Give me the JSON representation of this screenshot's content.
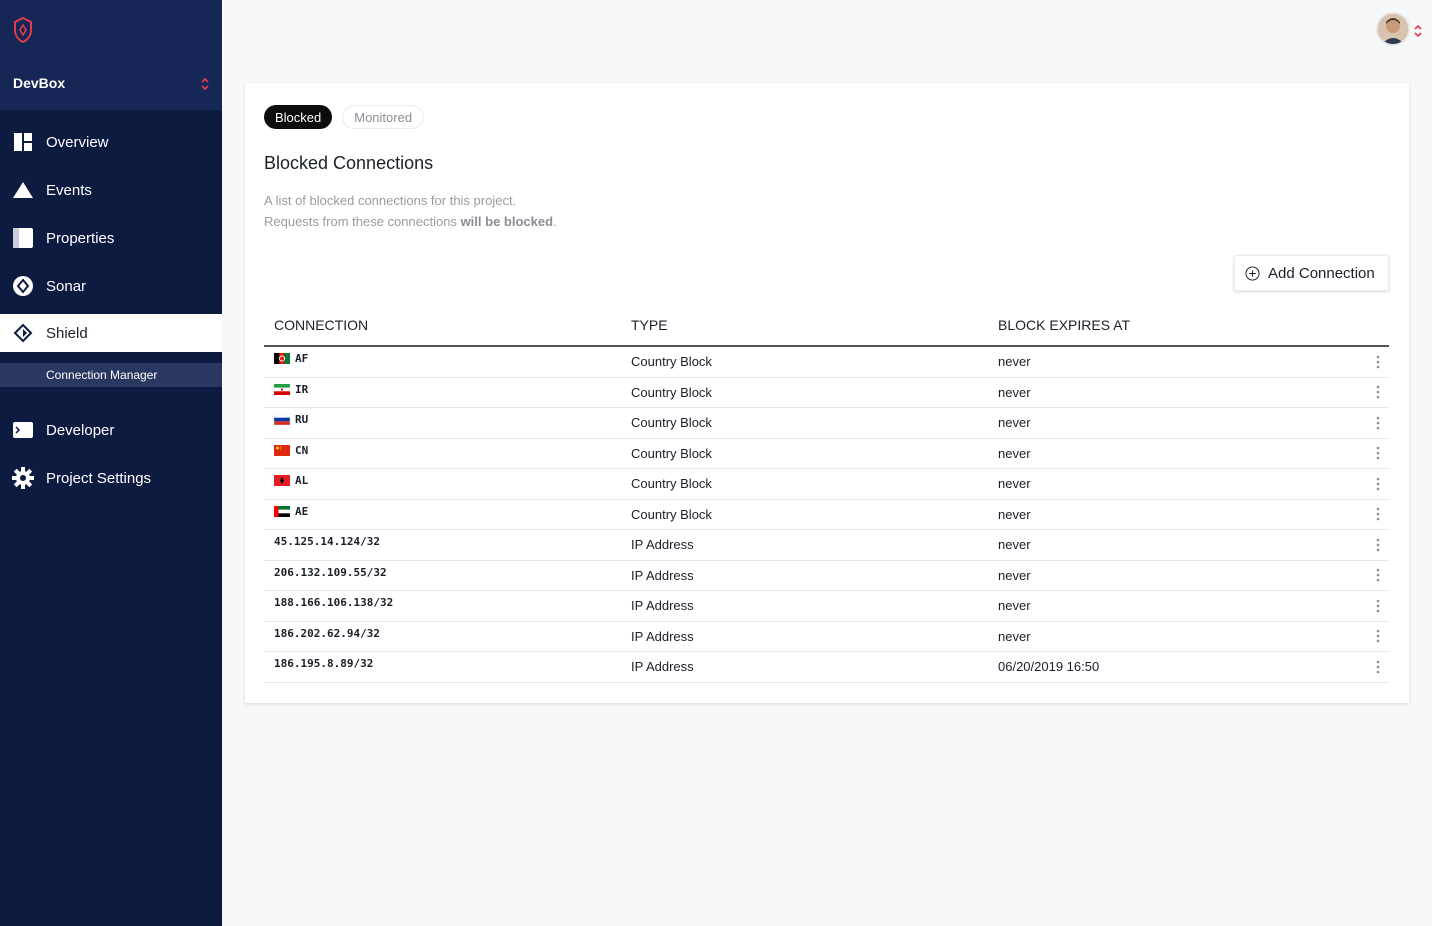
{
  "sidebar": {
    "project": "DevBox",
    "items": [
      {
        "label": "Overview",
        "icon": "overview-icon"
      },
      {
        "label": "Events",
        "icon": "events-icon"
      },
      {
        "label": "Properties",
        "icon": "properties-icon"
      },
      {
        "label": "Sonar",
        "icon": "sonar-icon"
      },
      {
        "label": "Shield",
        "icon": "shield-icon"
      },
      {
        "label": "Developer",
        "icon": "developer-icon"
      },
      {
        "label": "Project Settings",
        "icon": "gear-icon"
      }
    ],
    "subitem": "Connection Manager"
  },
  "tabs": {
    "blocked": "Blocked",
    "monitored": "Monitored"
  },
  "main": {
    "title": "Blocked Connections",
    "desc_line1": "A list of blocked connections for this project.",
    "desc_line2_pre": "Requests from these connections ",
    "desc_line2_bold": "will be blocked",
    "desc_line2_post": ".",
    "add_button": "Add Connection"
  },
  "table": {
    "headers": [
      "CONNECTION",
      "TYPE",
      "BLOCK EXPIRES AT"
    ],
    "rows": [
      {
        "connection": "AF",
        "type": "Country Block",
        "expires": "never",
        "flag": "af"
      },
      {
        "connection": "IR",
        "type": "Country Block",
        "expires": "never",
        "flag": "ir"
      },
      {
        "connection": "RU",
        "type": "Country Block",
        "expires": "never",
        "flag": "ru"
      },
      {
        "connection": "CN",
        "type": "Country Block",
        "expires": "never",
        "flag": "cn"
      },
      {
        "connection": "AL",
        "type": "Country Block",
        "expires": "never",
        "flag": "al"
      },
      {
        "connection": "AE",
        "type": "Country Block",
        "expires": "never",
        "flag": "ae"
      },
      {
        "connection": "45.125.14.124/32",
        "type": "IP Address",
        "expires": "never",
        "flag": ""
      },
      {
        "connection": "206.132.109.55/32",
        "type": "IP Address",
        "expires": "never",
        "flag": ""
      },
      {
        "connection": "188.166.106.138/32",
        "type": "IP Address",
        "expires": "never",
        "flag": ""
      },
      {
        "connection": "186.202.62.94/32",
        "type": "IP Address",
        "expires": "never",
        "flag": ""
      },
      {
        "connection": "186.195.8.89/32",
        "type": "IP Address",
        "expires": "06/20/2019 16:50",
        "flag": ""
      }
    ]
  },
  "colors": {
    "sidebar": "#0e1b40",
    "accent": "#e23b4e",
    "active_tab": "#0c0c0c"
  }
}
